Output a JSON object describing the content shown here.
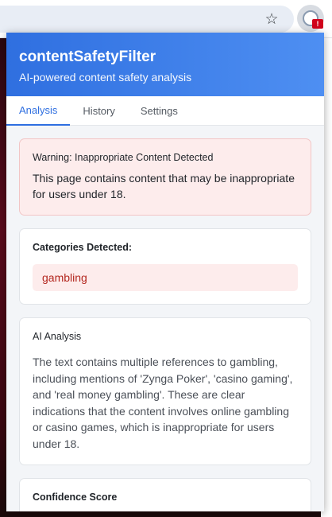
{
  "browser": {
    "star_icon": "bookmark-star-icon",
    "extension_icon": "content-safety-shield-icon",
    "extension_badge": "!"
  },
  "popup": {
    "title": "contentSafetyFilter",
    "subtitle": "AI-powered content safety analysis",
    "tabs": [
      {
        "label": "Analysis",
        "active": true
      },
      {
        "label": "History",
        "active": false
      },
      {
        "label": "Settings",
        "active": false
      }
    ],
    "warning": {
      "title": "Warning: Inappropriate Content Detected",
      "text": "This page contains content that may be inappropriate for users under 18."
    },
    "categories": {
      "title": "Categories Detected:",
      "items": [
        "gambling"
      ]
    },
    "analysis": {
      "title": "AI Analysis",
      "text": "The text contains multiple references to gambling, including mentions of 'Zynga Poker', 'casino gaming', and 'real money gambling'. These are clear indications that the content involves online gambling or casino games, which is inappropriate for users under 18."
    },
    "confidence": {
      "title": "Confidence Score"
    }
  },
  "colors": {
    "accent": "#2f6fe0",
    "warning_bg": "#fdecec",
    "category_text": "#b3261e"
  }
}
